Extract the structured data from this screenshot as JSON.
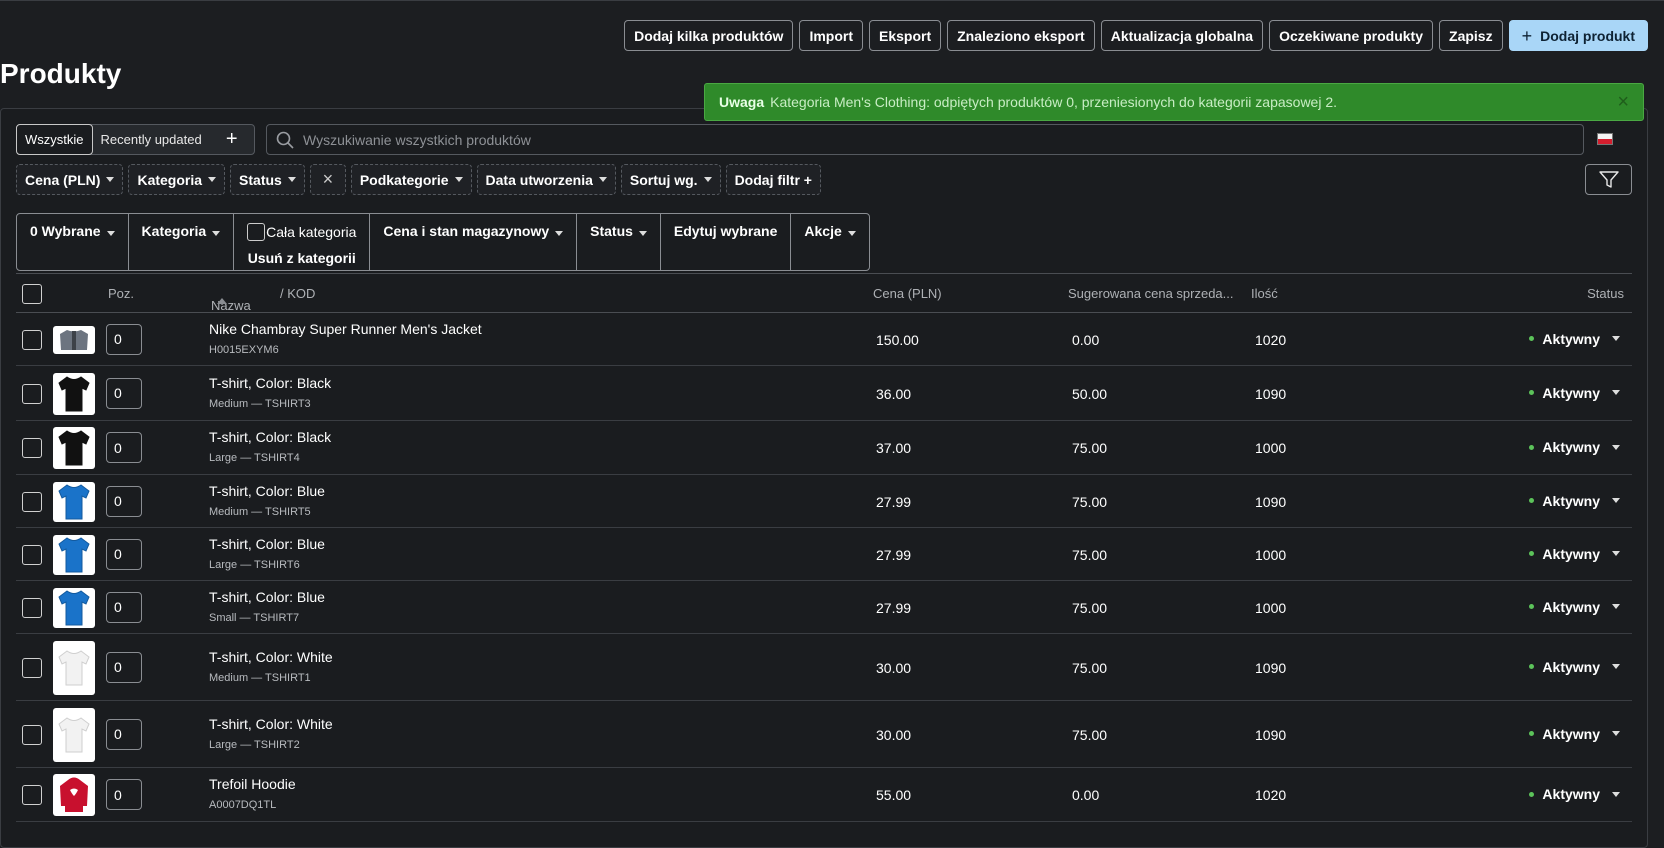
{
  "top_actions": {
    "add_many": "Dodaj kilka produktów",
    "import": "Import",
    "export": "Eksport",
    "found_export": "Znaleziono eksport",
    "global_update": "Aktualizacja globalna",
    "expected_products": "Oczekiwane produkty",
    "save": "Zapisz",
    "add_product": "Dodaj produkt"
  },
  "page_title": "Produkty",
  "notice": {
    "label": "Uwaga",
    "message": "Kategoria Men's Clothing: odpiętych produktów 0, przeniesionych do kategorii zapasowej 2."
  },
  "views": {
    "all": "Wszystkie",
    "recent": "Recently updated"
  },
  "search": {
    "placeholder": "Wyszukiwanie wszystkich produktów"
  },
  "filters": {
    "price": "Cena (PLN)",
    "category": "Kategoria",
    "status": "Status",
    "subcategories": "Podkategorie",
    "created": "Data utworzenia",
    "sort": "Sortuj wg.",
    "add_filter": "Dodaj filtr +"
  },
  "bulk": {
    "selected": "0 Wybrane",
    "category": "Kategoria",
    "whole_category": "Cała kategoria",
    "remove_from_category": "Usuń z kategorii",
    "price_stock": "Cena i stan magazynowy",
    "status": "Status",
    "edit_selected": "Edytuj wybrane",
    "actions": "Akcje"
  },
  "table": {
    "headers": {
      "pos": "Poz.",
      "name": "Nazwa",
      "code": "/  KOD",
      "price": "Cena (PLN)",
      "suggested": "Sugerowana cena sprzeda...",
      "qty": "Ilość",
      "status": "Status"
    },
    "rows": [
      {
        "name": "Nike Chambray Super Runner Men's Jacket",
        "sub": "H0015EXYM6",
        "pos": "0",
        "price": "150.00",
        "suggested": "0.00",
        "qty": "1020",
        "status": "Aktywny",
        "image": "jacket"
      },
      {
        "name": "T-shirt, Color: Black",
        "sub": "Medium — TSHIRT3",
        "pos": "0",
        "price": "36.00",
        "suggested": "50.00",
        "qty": "1090",
        "status": "Aktywny",
        "image": "tshirt-black"
      },
      {
        "name": "T-shirt, Color: Black",
        "sub": "Large — TSHIRT4",
        "pos": "0",
        "price": "37.00",
        "suggested": "75.00",
        "qty": "1000",
        "status": "Aktywny",
        "image": "tshirt-black"
      },
      {
        "name": "T-shirt, Color: Blue",
        "sub": "Medium — TSHIRT5",
        "pos": "0",
        "price": "27.99",
        "suggested": "75.00",
        "qty": "1090",
        "status": "Aktywny",
        "image": "tshirt-blue"
      },
      {
        "name": "T-shirt, Color: Blue",
        "sub": "Large — TSHIRT6",
        "pos": "0",
        "price": "27.99",
        "suggested": "75.00",
        "qty": "1000",
        "status": "Aktywny",
        "image": "tshirt-blue"
      },
      {
        "name": "T-shirt, Color: Blue",
        "sub": "Small — TSHIRT7",
        "pos": "0",
        "price": "27.99",
        "suggested": "75.00",
        "qty": "1000",
        "status": "Aktywny",
        "image": "tshirt-blue"
      },
      {
        "name": "T-shirt, Color: White",
        "sub": "Medium — TSHIRT1",
        "pos": "0",
        "price": "30.00",
        "suggested": "75.00",
        "qty": "1090",
        "status": "Aktywny",
        "image": "tshirt-white"
      },
      {
        "name": "T-shirt, Color: White",
        "sub": "Large — TSHIRT2",
        "pos": "0",
        "price": "30.00",
        "suggested": "75.00",
        "qty": "1090",
        "status": "Aktywny",
        "image": "tshirt-white"
      },
      {
        "name": "Trefoil Hoodie",
        "sub": "A0007DQ1TL",
        "pos": "0",
        "price": "55.00",
        "suggested": "0.00",
        "qty": "1020",
        "status": "Aktywny",
        "image": "hoodie-red"
      }
    ]
  },
  "colors": {
    "background": "#1c1e21",
    "notice_bg": "#2f8a2a",
    "primary_button": "#a9d6f7",
    "status_dot": "#5cc35a"
  }
}
